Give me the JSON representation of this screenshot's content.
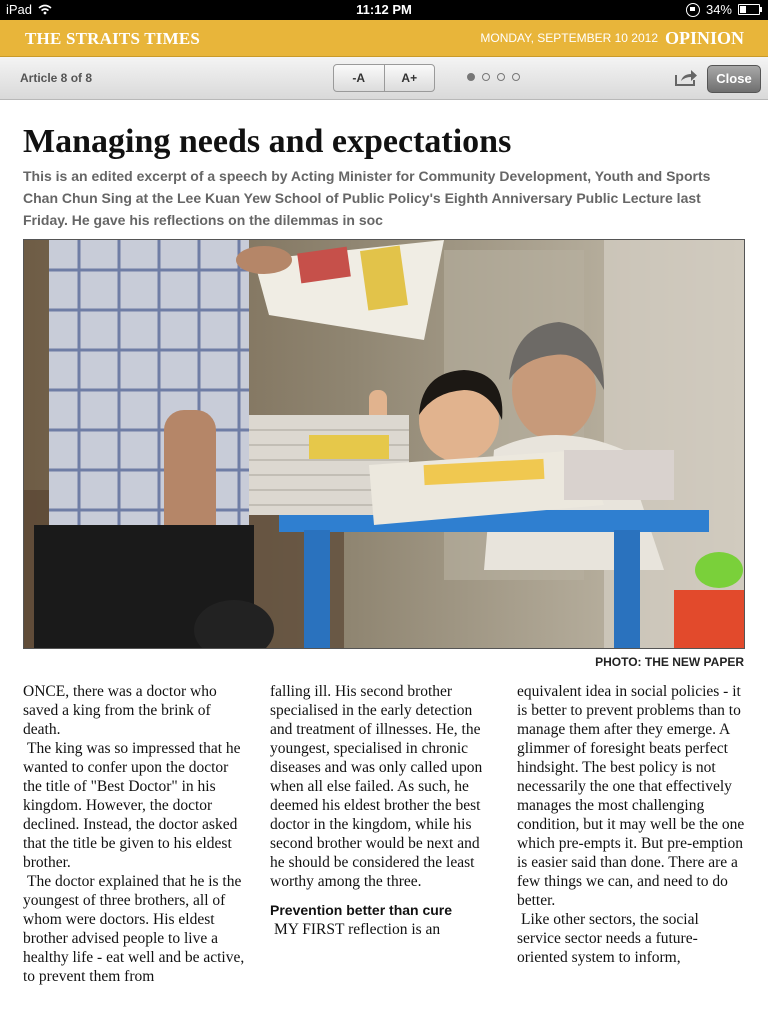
{
  "status_bar": {
    "device": "iPad",
    "time": "11:12 PM",
    "battery": "34%",
    "battery_level": 0.34
  },
  "masthead": {
    "brand": "THE STRAITS TIMES",
    "date": "MONDAY, SEPTEMBER 10 2012",
    "section": "OPINION",
    "accent_color": "#e8b53a"
  },
  "toolbar": {
    "article_count": "Article 8 of 8",
    "font_decrease": "-A",
    "font_increase": "A+",
    "pages_total": 4,
    "page_current": 1,
    "close_label": "Close"
  },
  "article": {
    "headline": "Managing needs and expectations",
    "standfirst": "This is an edited excerpt of a speech by Acting Minister for Community Development, Youth and Sports Chan Chun Sing at the Lee Kuan Yew School of Public Policy's Eighth Anniversary Public Lecture last Friday. He gave his reflections on the dilemmas in soc",
    "photo_credit": "PHOTO: THE NEW PAPER",
    "columns": [
      {
        "paragraphs": [
          "ONCE, there was a doctor who saved a king from the brink of death.",
          "The king was so impressed that he wanted to confer upon the doctor the title of \"Best Doctor\" in his kingdom. However, the doctor declined. Instead, the doctor asked that the title be given to his eldest brother.",
          "The doctor explained that he is the youngest of three brothers, all of whom were doctors. His eldest brother advised people to live a healthy life - eat well and be active, to prevent them from"
        ]
      },
      {
        "paragraphs": [
          "falling ill. His second brother specialised in the early detection and treatment of illnesses. He, the youngest, specialised in chronic diseases and was only called upon when all else failed. As such, he deemed his eldest brother the best doctor in the kingdom, while his second brother would be next and he should be considered the least worthy among the three."
        ],
        "subhead": "Prevention better than cure",
        "after": "MY FIRST reflection is an"
      },
      {
        "paragraphs": [
          "equivalent idea in social policies - it is better to prevent problems than to manage them after they emerge. A glimmer of foresight beats perfect hindsight. The best policy is not necessarily the one that effectively manages the most challenging condition, but it may well be the one which pre-empts it. But pre-emption is easier said than done. There are a few things we can, and need to do better.",
          "Like other sectors, the social service sector needs a future-oriented system to inform,"
        ]
      }
    ]
  }
}
